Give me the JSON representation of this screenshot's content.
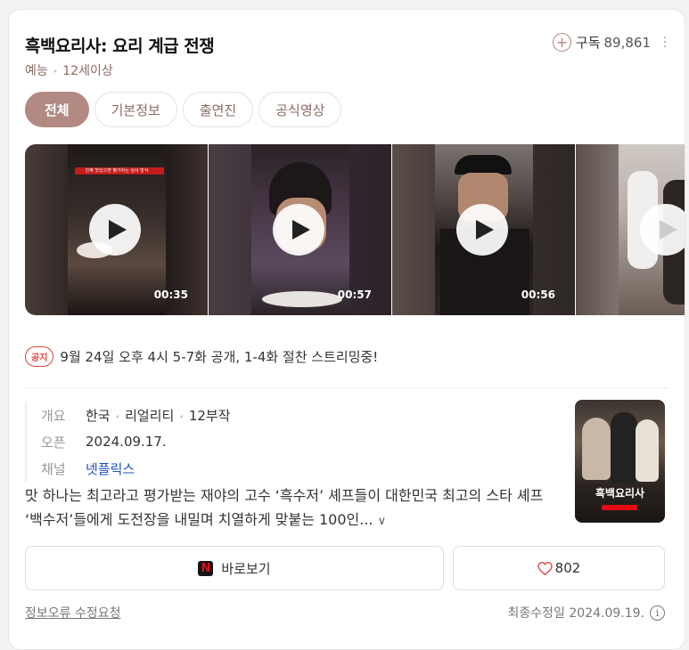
{
  "program": {
    "title": "흑백요리사: 요리 계급 전쟁",
    "genre": "예능",
    "rating": "12세이상"
  },
  "subscribe": {
    "label": "구독",
    "count": "89,861"
  },
  "tabs": [
    {
      "label": "전체",
      "active": true
    },
    {
      "label": "기본정보",
      "active": false
    },
    {
      "label": "출연진",
      "active": false
    },
    {
      "label": "공식영상",
      "active": false
    }
  ],
  "videos": [
    {
      "duration": "00:35",
      "caption": "진짜 맛있으면 평가하는 심사 방식"
    },
    {
      "duration": "00:57"
    },
    {
      "duration": "00:56"
    },
    {
      "duration": ""
    }
  ],
  "notice": {
    "badge": "공지",
    "text": "9월 24일 오후 4시 5-7화 공개, 1-4화 절찬 스트리밍중!"
  },
  "info": {
    "overview_key": "개요",
    "overview_country": "한국",
    "overview_genre": "리얼리티",
    "overview_episodes": "12부작",
    "open_key": "오픈",
    "open_value": "2024.09.17.",
    "channel_key": "채널",
    "channel_value": "넷플릭스"
  },
  "synopsis": "맛 하나는 최고라고 평가받는 재야의 고수 ‘흑수저’ 셰프들이 대한민국 최고의 스타 셰프 ‘백수저’들에게 도전장을 내밀며 치열하게 맞붙는 100인...",
  "actions": {
    "watch_label": "바로보기",
    "like_count": "802"
  },
  "footer": {
    "report_label": "정보오류 수정요청",
    "last_modified": "최종수정일 2024.09.19."
  },
  "colors": {
    "accent": "#b28a83",
    "netflix_red": "#e50914",
    "notice_red": "#e0433c",
    "link_blue": "#1b4fbf"
  }
}
